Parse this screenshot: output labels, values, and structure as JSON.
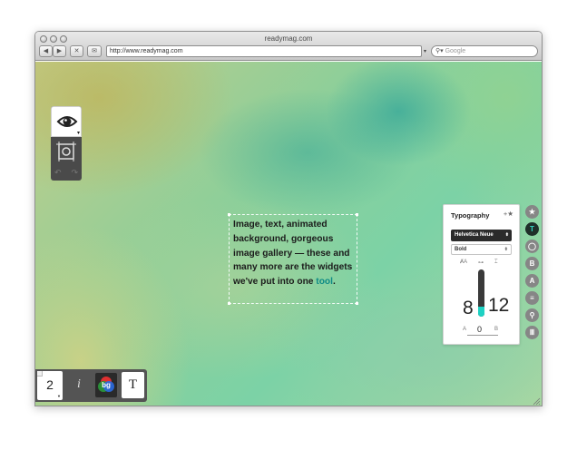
{
  "browser": {
    "title": "readymag.com",
    "url": "http://www.readymag.com",
    "search_placeholder": "Google",
    "back_label": "◀",
    "forward_label": "▶",
    "stop_label": "✕",
    "bookmark_label": "✉"
  },
  "left_tools": {
    "preview_icon": "eye-icon",
    "crop_icon": "crop-icon",
    "undo_label": "↶",
    "redo_label": "↷"
  },
  "text_widget": {
    "text_before": "Image, text, animated background, gorgeous image gallery — these and many more are the widgets we've put into one ",
    "text_highlight": "tool",
    "text_after": "."
  },
  "typography_panel": {
    "title": "Typography",
    "favorite_label": "+★",
    "font": "Helvetica Neue",
    "weight": "Bold",
    "size_icon_label": "ȺA",
    "link_icon_label": "⊶",
    "leading_icon_label": "⌶",
    "font_size": "8",
    "line_height": "12",
    "slider_level": 0.22,
    "tracking_left_label": "A",
    "tracking_right_label": "B",
    "tracking_value": "0"
  },
  "side_tools": [
    {
      "name": "star-tool",
      "glyph": "★",
      "active": false
    },
    {
      "name": "text-tool",
      "glyph": "T",
      "active": true
    },
    {
      "name": "circle-tool",
      "glyph": "◯",
      "active": false
    },
    {
      "name": "bold-tool",
      "glyph": "B",
      "active": false
    },
    {
      "name": "font-tool",
      "glyph": "A",
      "active": false
    },
    {
      "name": "align-tool",
      "glyph": "≡",
      "active": false
    },
    {
      "name": "link-tool",
      "glyph": "⚲",
      "active": false
    },
    {
      "name": "columns-tool",
      "glyph": "Ⅲ",
      "active": false
    }
  ],
  "bottom_bar": {
    "page_number": "2",
    "info_label": "i",
    "bg_label": "bg",
    "text_label": "T"
  },
  "colors": {
    "accent": "#1ed2c4",
    "highlight_text": "#0d8b86",
    "panel_dark": "#4a4a4a"
  }
}
